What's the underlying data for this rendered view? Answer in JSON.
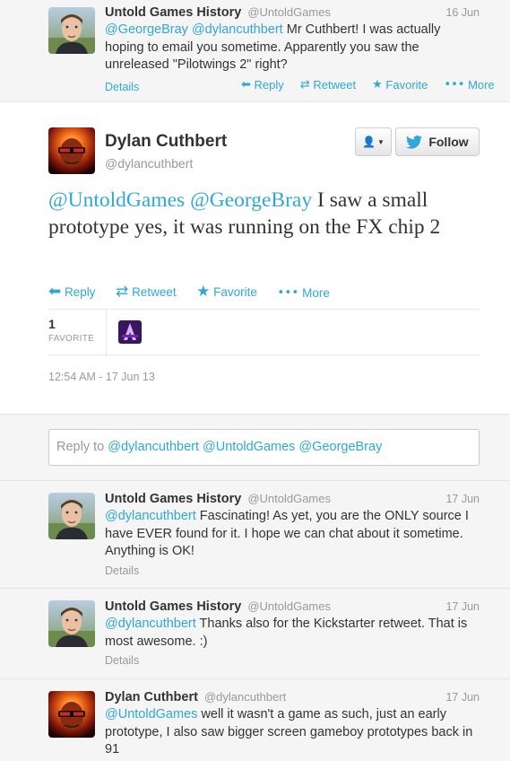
{
  "colors": {
    "link": "#2fa7d9",
    "muted": "#999999",
    "text": "#333333",
    "grey_bg": "#f5f5f5"
  },
  "top_tweet": {
    "name": "Untold Games History",
    "handle": "@UntoldGames",
    "date": "16 Jun",
    "mention1": "@GeorgeBray",
    "mention2": "@dylancuthbert",
    "text": " Mr Cuthbert! I was actually hoping to email you sometime. Apparently you saw the unreleased \"Pilotwings 2\" right?",
    "details": "Details",
    "actions": {
      "reply": "Reply",
      "retweet": "Retweet",
      "favorite": "Favorite",
      "more": "More"
    }
  },
  "main_tweet": {
    "name": "Dylan Cuthbert",
    "handle": "@dylancuthbert",
    "follow_label": "Follow",
    "mention1": "@UntoldGames",
    "mention2": "@GeorgeBray",
    "text": " I saw a small prototype yes, it was running on the FX chip 2",
    "actions": {
      "reply": "Reply",
      "retweet": "Retweet",
      "favorite": "Favorite",
      "more": "More"
    },
    "favorite_count": "1",
    "favorite_label": "FAVORITE",
    "timestamp": "12:54 AM - 17 Jun 13"
  },
  "reply_box": {
    "prefix": "Reply to ",
    "mentions": "@dylancuthbert @UntoldGames @GeorgeBray"
  },
  "replies": [
    {
      "name": "Untold Games History",
      "handle": "@UntoldGames",
      "date": "17 Jun",
      "mention": "@dylancuthbert",
      "text": " Fascinating! As yet, you are the ONLY source I have EVER found for it. I hope we can chat about it sometime. Anything is OK!",
      "details": "Details"
    },
    {
      "name": "Untold Games History",
      "handle": "@UntoldGames",
      "date": "17 Jun",
      "mention": "@dylancuthbert",
      "text": " Thanks also for the Kickstarter retweet. That is most awesome. :)",
      "details": "Details"
    },
    {
      "name": "Dylan Cuthbert",
      "handle": "@dylancuthbert",
      "date": "17 Jun",
      "mention": "@UntoldGames",
      "text": " well it wasn't a game as such, just an early prototype, I also saw bigger screen gameboy prototypes back in 91"
    }
  ]
}
